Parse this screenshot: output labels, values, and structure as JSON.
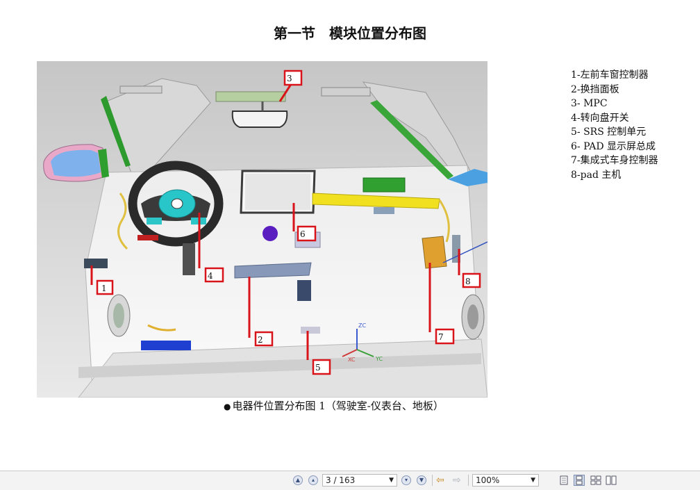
{
  "page": {
    "title": "第一节　模块位置分布图",
    "caption": "电器件位置分布图 1（驾驶室-仪表台、地板）",
    "caption_bullet": "●"
  },
  "legend": [
    "1-左前车窗控制器",
    "2-换挡面板",
    "3- MPC",
    "4-转向盘开关",
    "5- SRS 控制单元",
    "6- PAD 显示屏总成",
    "7-集成式车身控制器",
    "8-pad 主机"
  ],
  "callouts": [
    "1",
    "2",
    "3",
    "4",
    "5",
    "6",
    "7",
    "8"
  ],
  "axis_labels": {
    "zc": "ZC",
    "xc": "XC",
    "yc": "YC"
  },
  "viewer": {
    "page_display": "3 / 163",
    "zoom": "100%",
    "icons": [
      "first-page-icon",
      "prev-page-icon",
      "next-page-icon",
      "last-page-icon",
      "back-arrow-icon",
      "forward-arrow-icon",
      "single-page-icon",
      "continuous-icon",
      "facing-icon",
      "continuous-facing-icon"
    ]
  },
  "colors": {
    "callout_red": "#d8141a",
    "accent_blue": "#2048c8",
    "accent_green": "#28a028",
    "highlight_yellow": "#f0e020"
  }
}
